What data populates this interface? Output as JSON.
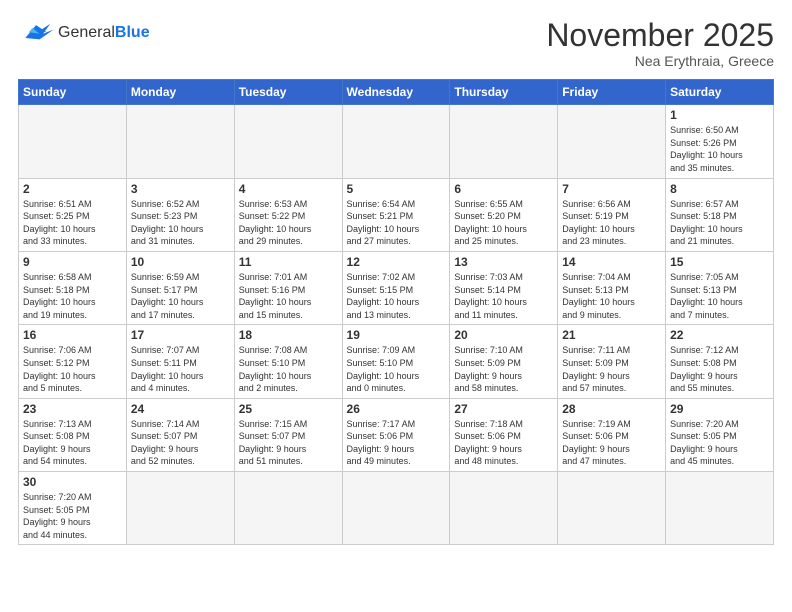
{
  "header": {
    "logo_line1": "General",
    "logo_line2": "Blue",
    "month_title": "November 2025",
    "subtitle": "Nea Erythraia, Greece"
  },
  "weekdays": [
    "Sunday",
    "Monday",
    "Tuesday",
    "Wednesday",
    "Thursday",
    "Friday",
    "Saturday"
  ],
  "weeks": [
    [
      {
        "day": "",
        "info": ""
      },
      {
        "day": "",
        "info": ""
      },
      {
        "day": "",
        "info": ""
      },
      {
        "day": "",
        "info": ""
      },
      {
        "day": "",
        "info": ""
      },
      {
        "day": "",
        "info": ""
      },
      {
        "day": "1",
        "info": "Sunrise: 6:50 AM\nSunset: 5:26 PM\nDaylight: 10 hours\nand 35 minutes."
      }
    ],
    [
      {
        "day": "2",
        "info": "Sunrise: 6:51 AM\nSunset: 5:25 PM\nDaylight: 10 hours\nand 33 minutes."
      },
      {
        "day": "3",
        "info": "Sunrise: 6:52 AM\nSunset: 5:23 PM\nDaylight: 10 hours\nand 31 minutes."
      },
      {
        "day": "4",
        "info": "Sunrise: 6:53 AM\nSunset: 5:22 PM\nDaylight: 10 hours\nand 29 minutes."
      },
      {
        "day": "5",
        "info": "Sunrise: 6:54 AM\nSunset: 5:21 PM\nDaylight: 10 hours\nand 27 minutes."
      },
      {
        "day": "6",
        "info": "Sunrise: 6:55 AM\nSunset: 5:20 PM\nDaylight: 10 hours\nand 25 minutes."
      },
      {
        "day": "7",
        "info": "Sunrise: 6:56 AM\nSunset: 5:19 PM\nDaylight: 10 hours\nand 23 minutes."
      },
      {
        "day": "8",
        "info": "Sunrise: 6:57 AM\nSunset: 5:18 PM\nDaylight: 10 hours\nand 21 minutes."
      }
    ],
    [
      {
        "day": "9",
        "info": "Sunrise: 6:58 AM\nSunset: 5:18 PM\nDaylight: 10 hours\nand 19 minutes."
      },
      {
        "day": "10",
        "info": "Sunrise: 6:59 AM\nSunset: 5:17 PM\nDaylight: 10 hours\nand 17 minutes."
      },
      {
        "day": "11",
        "info": "Sunrise: 7:01 AM\nSunset: 5:16 PM\nDaylight: 10 hours\nand 15 minutes."
      },
      {
        "day": "12",
        "info": "Sunrise: 7:02 AM\nSunset: 5:15 PM\nDaylight: 10 hours\nand 13 minutes."
      },
      {
        "day": "13",
        "info": "Sunrise: 7:03 AM\nSunset: 5:14 PM\nDaylight: 10 hours\nand 11 minutes."
      },
      {
        "day": "14",
        "info": "Sunrise: 7:04 AM\nSunset: 5:13 PM\nDaylight: 10 hours\nand 9 minutes."
      },
      {
        "day": "15",
        "info": "Sunrise: 7:05 AM\nSunset: 5:13 PM\nDaylight: 10 hours\nand 7 minutes."
      }
    ],
    [
      {
        "day": "16",
        "info": "Sunrise: 7:06 AM\nSunset: 5:12 PM\nDaylight: 10 hours\nand 5 minutes."
      },
      {
        "day": "17",
        "info": "Sunrise: 7:07 AM\nSunset: 5:11 PM\nDaylight: 10 hours\nand 4 minutes."
      },
      {
        "day": "18",
        "info": "Sunrise: 7:08 AM\nSunset: 5:10 PM\nDaylight: 10 hours\nand 2 minutes."
      },
      {
        "day": "19",
        "info": "Sunrise: 7:09 AM\nSunset: 5:10 PM\nDaylight: 10 hours\nand 0 minutes."
      },
      {
        "day": "20",
        "info": "Sunrise: 7:10 AM\nSunset: 5:09 PM\nDaylight: 9 hours\nand 58 minutes."
      },
      {
        "day": "21",
        "info": "Sunrise: 7:11 AM\nSunset: 5:09 PM\nDaylight: 9 hours\nand 57 minutes."
      },
      {
        "day": "22",
        "info": "Sunrise: 7:12 AM\nSunset: 5:08 PM\nDaylight: 9 hours\nand 55 minutes."
      }
    ],
    [
      {
        "day": "23",
        "info": "Sunrise: 7:13 AM\nSunset: 5:08 PM\nDaylight: 9 hours\nand 54 minutes."
      },
      {
        "day": "24",
        "info": "Sunrise: 7:14 AM\nSunset: 5:07 PM\nDaylight: 9 hours\nand 52 minutes."
      },
      {
        "day": "25",
        "info": "Sunrise: 7:15 AM\nSunset: 5:07 PM\nDaylight: 9 hours\nand 51 minutes."
      },
      {
        "day": "26",
        "info": "Sunrise: 7:17 AM\nSunset: 5:06 PM\nDaylight: 9 hours\nand 49 minutes."
      },
      {
        "day": "27",
        "info": "Sunrise: 7:18 AM\nSunset: 5:06 PM\nDaylight: 9 hours\nand 48 minutes."
      },
      {
        "day": "28",
        "info": "Sunrise: 7:19 AM\nSunset: 5:06 PM\nDaylight: 9 hours\nand 47 minutes."
      },
      {
        "day": "29",
        "info": "Sunrise: 7:20 AM\nSunset: 5:05 PM\nDaylight: 9 hours\nand 45 minutes."
      }
    ],
    [
      {
        "day": "30",
        "info": "Sunrise: 7:20 AM\nSunset: 5:05 PM\nDaylight: 9 hours\nand 44 minutes."
      },
      {
        "day": "",
        "info": ""
      },
      {
        "day": "",
        "info": ""
      },
      {
        "day": "",
        "info": ""
      },
      {
        "day": "",
        "info": ""
      },
      {
        "day": "",
        "info": ""
      },
      {
        "day": "",
        "info": ""
      }
    ]
  ]
}
